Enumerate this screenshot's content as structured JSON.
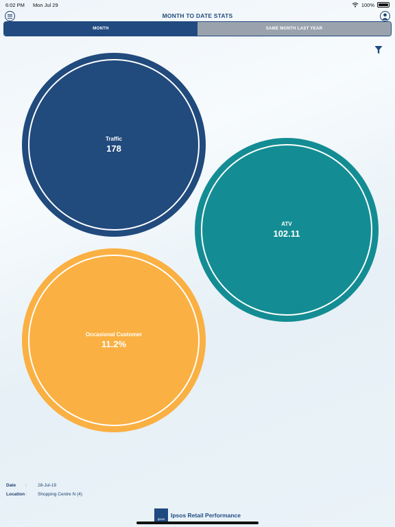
{
  "status_bar": {
    "time": "6:02 PM",
    "date": "Mon Jul 29",
    "battery": "100%"
  },
  "header": {
    "title": "MONTH TO DATE STATS"
  },
  "tabs": [
    {
      "label": "MONTH",
      "active": true
    },
    {
      "label": "SAME MONTH LAST YEAR",
      "active": false
    }
  ],
  "metrics": {
    "traffic": {
      "label": "Traffic",
      "value": "178",
      "color": "#214a7d"
    },
    "atv": {
      "label": "ATV",
      "value": "102.11",
      "color": "#138d93"
    },
    "occasional": {
      "label": "Occasional Customer",
      "value": "11.2%",
      "color": "#fab042"
    }
  },
  "info": {
    "date_label": "Date",
    "date_sep": ":",
    "date_value": "28-Jul-19",
    "location_label": "Location",
    "location_sep": ":",
    "location_value": "Shopping Centre N (4)"
  },
  "footer": {
    "logo_text": "Ipsos",
    "brand": "Ipsos Retail Performance"
  },
  "icons": {
    "menu": "menu-icon",
    "profile": "profile-icon",
    "filter": "filter-icon",
    "wifi": "wifi-icon",
    "battery": "battery-icon"
  }
}
